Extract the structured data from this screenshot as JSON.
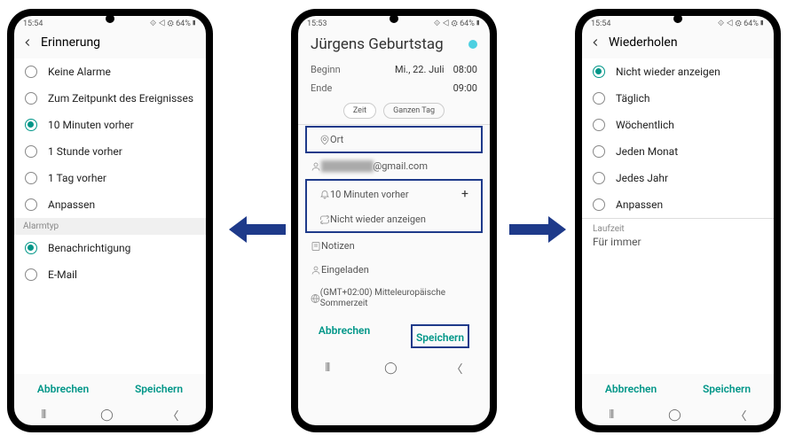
{
  "status": {
    "time1": "15:54",
    "time2": "15:53",
    "time3": "15:54",
    "right": "⟐ ◁ ⚙ 64%▮"
  },
  "screen1": {
    "title": "Erinnerung",
    "options": [
      "Keine Alarme",
      "Zum Zeitpunkt des Ereignisses",
      "10 Minuten vorher",
      "1 Stunde vorher",
      "1 Tag vorher",
      "Anpassen"
    ],
    "selected_index": 2,
    "alarm_type_label": "Alarmtyp",
    "alarm_types": [
      "Benachrichtigung",
      "E-Mail"
    ],
    "alarm_selected_index": 0
  },
  "screen2": {
    "event_title": "Jürgens Geburtstag",
    "begin_label": "Beginn",
    "begin_date": "Mi., 22. Juli",
    "begin_time": "08:00",
    "end_label": "Ende",
    "end_time": "09:00",
    "time_toggle": "Zeit",
    "allday_toggle": "Ganzen Tag",
    "location_label": "Ort",
    "account_suffix": "@gmail.com",
    "reminder_text": "10 Minuten vorher",
    "repeat_text": "Nicht wieder anzeigen",
    "notes_label": "Notizen",
    "invited_label": "Eingeladen",
    "timezone_label": "(GMT+02:00) Mitteleuropäische Sommerzeit"
  },
  "screen3": {
    "title": "Wiederholen",
    "options": [
      "Nicht wieder anzeigen",
      "Täglich",
      "Wöchentlich",
      "Jeden Monat",
      "Jedes Jahr",
      "Anpassen"
    ],
    "selected_index": 0,
    "runtime_label": "Laufzeit",
    "runtime_value": "Für immer"
  },
  "footer": {
    "cancel": "Abbrechen",
    "save": "Speichern"
  },
  "icons": {
    "location": "location-pin-icon",
    "account": "user-icon",
    "bell": "bell-icon",
    "repeat": "repeat-icon",
    "notes": "notes-icon",
    "invited": "person-icon",
    "globe": "globe-icon",
    "plus": "+",
    "back": "chevron-left-icon"
  },
  "colors": {
    "accent": "#009688",
    "highlight_border": "#1e3a8a",
    "event_color": "#4dd0e1"
  }
}
